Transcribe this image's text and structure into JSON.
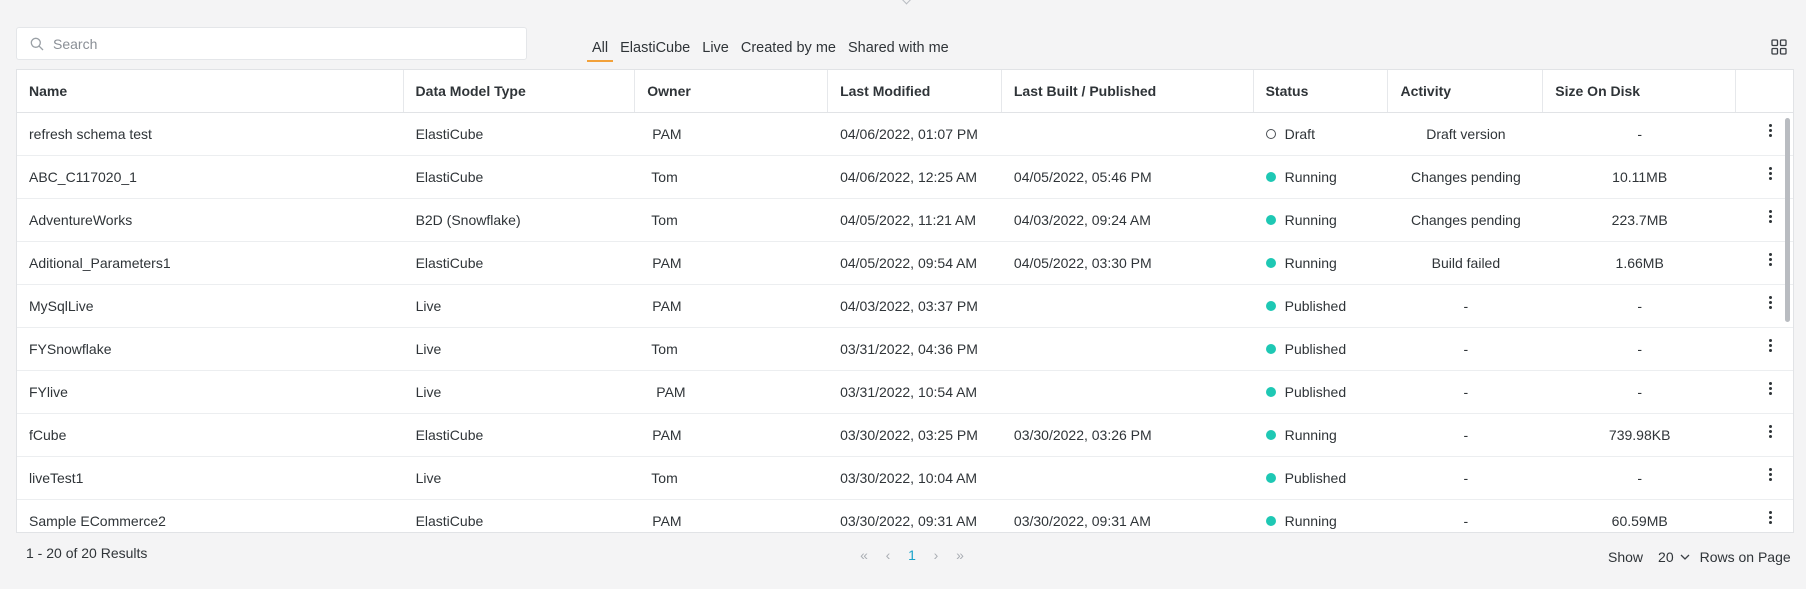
{
  "search": {
    "placeholder": "Search"
  },
  "filters": [
    "All",
    "ElastiCube",
    "Live",
    "Created by me",
    "Shared with me"
  ],
  "table": {
    "columns": [
      "Name",
      "Data Model Type",
      "Owner",
      "Last Modified",
      "Last Built / Published",
      "Status",
      "Activity",
      "Size On Disk"
    ],
    "rows": [
      {
        "name": "refresh schema test",
        "type": "ElastiCube",
        "owner": "PAM",
        "modified": "04/06/2022, 01:07 PM",
        "built": "",
        "status": "Draft",
        "activity": "Draft version",
        "size": "-"
      },
      {
        "name": "ABC_C117020_1",
        "type": "ElastiCube",
        "owner": "Tom",
        "modified": "04/06/2022, 12:25 AM",
        "built": "04/05/2022, 05:46 PM",
        "status": "Running",
        "activity": "Changes pending",
        "size": "10.11MB"
      },
      {
        "name": "AdventureWorks",
        "type": "B2D (Snowflake)",
        "owner": "Tom",
        "modified": "04/05/2022, 11:21 AM",
        "built": "04/03/2022, 09:24 AM",
        "status": "Running",
        "activity": "Changes pending",
        "size": "223.7MB"
      },
      {
        "name": "Aditional_Parameters1",
        "type": "ElastiCube",
        "owner": "PAM",
        "modified": "04/05/2022, 09:54 AM",
        "built": "04/05/2022, 03:30 PM",
        "status": "Running",
        "activity": "Build failed",
        "size": "1.66MB"
      },
      {
        "name": "MySqlLive",
        "type": "Live",
        "owner": "PAM",
        "modified": "04/03/2022, 03:37 PM",
        "built": "",
        "status": "Published",
        "activity": "-",
        "size": "-"
      },
      {
        "name": "FYSnowflake",
        "type": "Live",
        "owner": "Tom",
        "modified": "03/31/2022, 04:36 PM",
        "built": "",
        "status": "Published",
        "activity": "-",
        "size": "-"
      },
      {
        "name": "FYlive",
        "type": "Live",
        "owner": "PAM",
        "modified": "03/31/2022, 10:54 AM",
        "built": "",
        "status": "Published",
        "activity": "-",
        "size": "-"
      },
      {
        "name": "fCube",
        "type": "ElastiCube",
        "owner": "PAM",
        "modified": "03/30/2022, 03:25 PM",
        "built": "03/30/2022, 03:26 PM",
        "status": "Running",
        "activity": "-",
        "size": "739.98KB"
      },
      {
        "name": "liveTest1",
        "type": "Live",
        "owner": "Tom",
        "modified": "03/30/2022, 10:04 AM",
        "built": "",
        "status": "Published",
        "activity": "-",
        "size": "-"
      },
      {
        "name": "Sample ECommerce2",
        "type": "ElastiCube",
        "owner": "PAM",
        "modified": "03/30/2022, 09:31 AM",
        "built": "03/30/2022, 09:31 AM",
        "status": "Running",
        "activity": "-",
        "size": "60.59MB"
      }
    ]
  },
  "footer": {
    "results": "1 - 20 of 20 Results",
    "page": "1",
    "show_label": "Show",
    "rows_value": "20",
    "rows_label": "Rows on Page"
  },
  "colors": {
    "accent": "#f2a13a",
    "status_active": "#1ec8b4",
    "pager_current": "#1aa3c9"
  }
}
